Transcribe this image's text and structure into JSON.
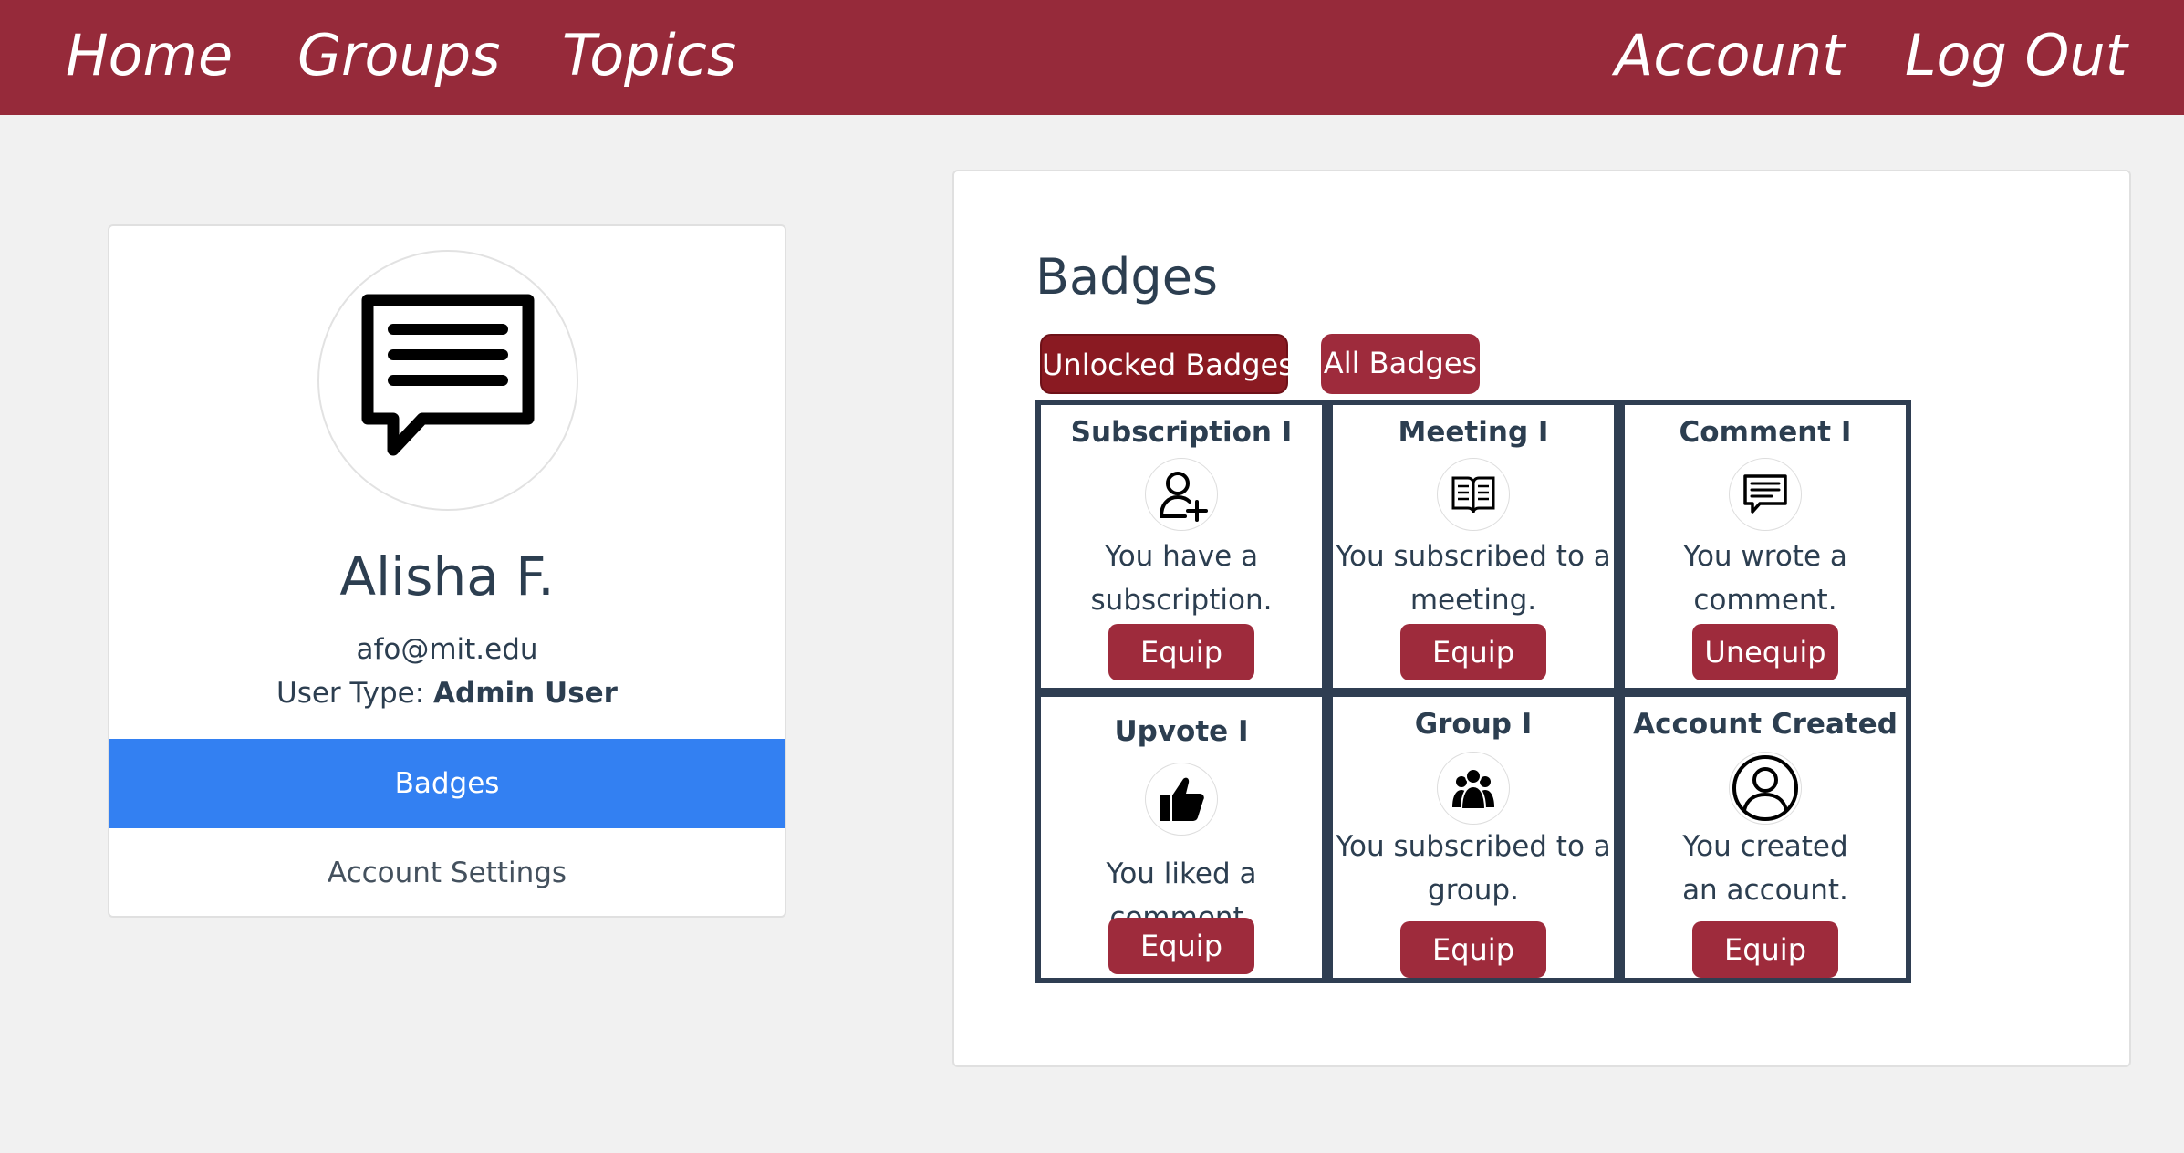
{
  "nav": {
    "home": "Home",
    "groups": "Groups",
    "topics": "Topics",
    "account": "Account",
    "logout": "Log Out"
  },
  "profile": {
    "avatar_icon": "chat-bubble-icon",
    "name": "Alisha F.",
    "email": "afo@mit.edu",
    "user_type_label": "User Type:",
    "user_type_value": "Admin User"
  },
  "menu": {
    "badges": "Badges",
    "account_settings": "Account Settings"
  },
  "badges": {
    "heading": "Badges",
    "filter_unlocked": "Unlocked Badges",
    "filter_all": "All Badges",
    "items": [
      {
        "title": "Subscription I",
        "icon": "user-plus-icon",
        "desc": "You have a subscription.",
        "button": "Equip"
      },
      {
        "title": "Meeting I",
        "icon": "open-book-icon",
        "desc": "You subscribed to a meeting.",
        "button": "Equip"
      },
      {
        "title": "Comment I",
        "icon": "comment-icon",
        "desc": "You wrote a comment.",
        "button": "Unequip"
      },
      {
        "title": "Upvote I",
        "icon": "thumbs-up-icon",
        "desc": "You liked a comment.",
        "button": "Equip"
      },
      {
        "title": "Group I",
        "icon": "group-icon",
        "desc": "You subscribed to a group.",
        "button": "Equip"
      },
      {
        "title": "Account Created",
        "icon": "user-circle-icon",
        "desc": "You created an account.",
        "button": "Equip"
      }
    ]
  },
  "colors": {
    "nav_bg": "#962a3a",
    "button_bg": "#9e2b3c",
    "active_menu": "#3380f2",
    "grid_border": "#2f3e52"
  }
}
